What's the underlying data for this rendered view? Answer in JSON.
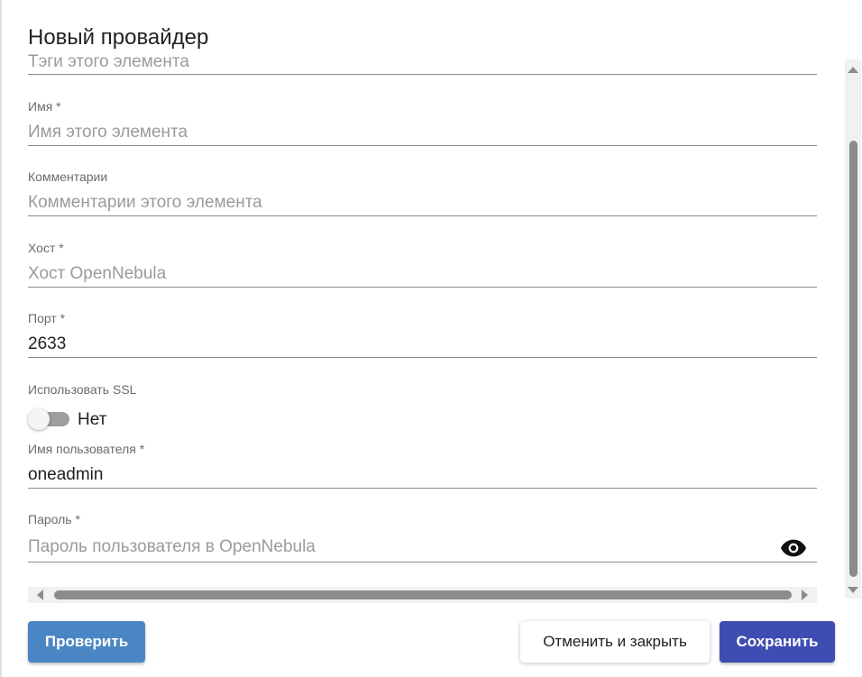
{
  "dialog": {
    "title": "Новый провайдер"
  },
  "fields": {
    "tags": {
      "placeholder": "Тэги этого элемента",
      "value": ""
    },
    "name": {
      "label": "Имя *",
      "placeholder": "Имя этого элемента",
      "value": ""
    },
    "comments": {
      "label": "Комментарии",
      "placeholder": "Комментарии этого элемента",
      "value": ""
    },
    "host": {
      "label": "Хост *",
      "placeholder": "Хост OpenNebula",
      "value": ""
    },
    "port": {
      "label": "Порт *",
      "placeholder": "",
      "value": "2633"
    },
    "ssl": {
      "label": "Использовать SSL",
      "state_text": "Нет",
      "checked": false
    },
    "username": {
      "label": "Имя пользователя *",
      "placeholder": "",
      "value": "oneadmin"
    },
    "password": {
      "label": "Пароль *",
      "placeholder": "Пароль пользователя в OpenNebula",
      "value": "",
      "icon": "eye-icon"
    }
  },
  "buttons": {
    "check": "Проверить",
    "cancel": "Отменить и закрыть",
    "save": "Сохранить"
  },
  "colors": {
    "check_button": "#4a86c3",
    "save_button": "#3f4db2",
    "scroll_thumb": "#8c8c8c"
  }
}
